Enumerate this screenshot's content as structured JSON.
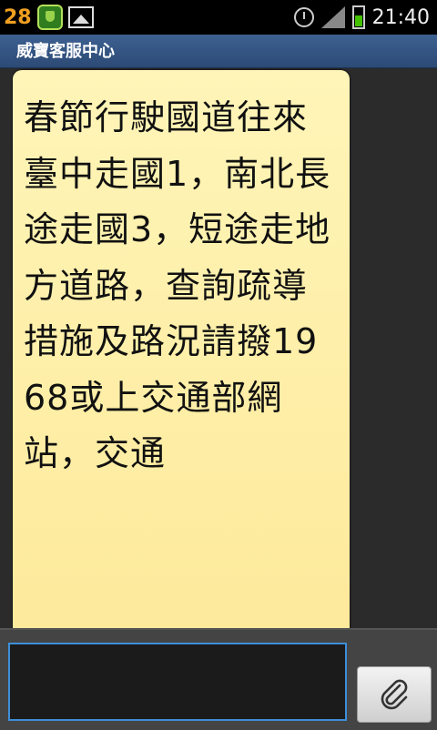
{
  "status_bar": {
    "notification_count": "28",
    "time": "21:40",
    "icons": [
      "shield-icon",
      "gallery-icon",
      "alarm-icon",
      "signal-icon",
      "battery-icon"
    ]
  },
  "header": {
    "title": "威寶客服中心"
  },
  "message": {
    "text": "春節行駛國道往來臺中走國1，南北長途走國3，短途走地方道路，查詢疏導措施及路況請撥1968或上交通部網站，交通"
  },
  "compose": {
    "value": "",
    "placeholder": "",
    "attach_icon": "paperclip-icon"
  },
  "colors": {
    "title_bar": "#34557f",
    "bubble": "#fdeea6",
    "input_border": "#3d8fd9",
    "accent_orange": "#f0a020"
  }
}
